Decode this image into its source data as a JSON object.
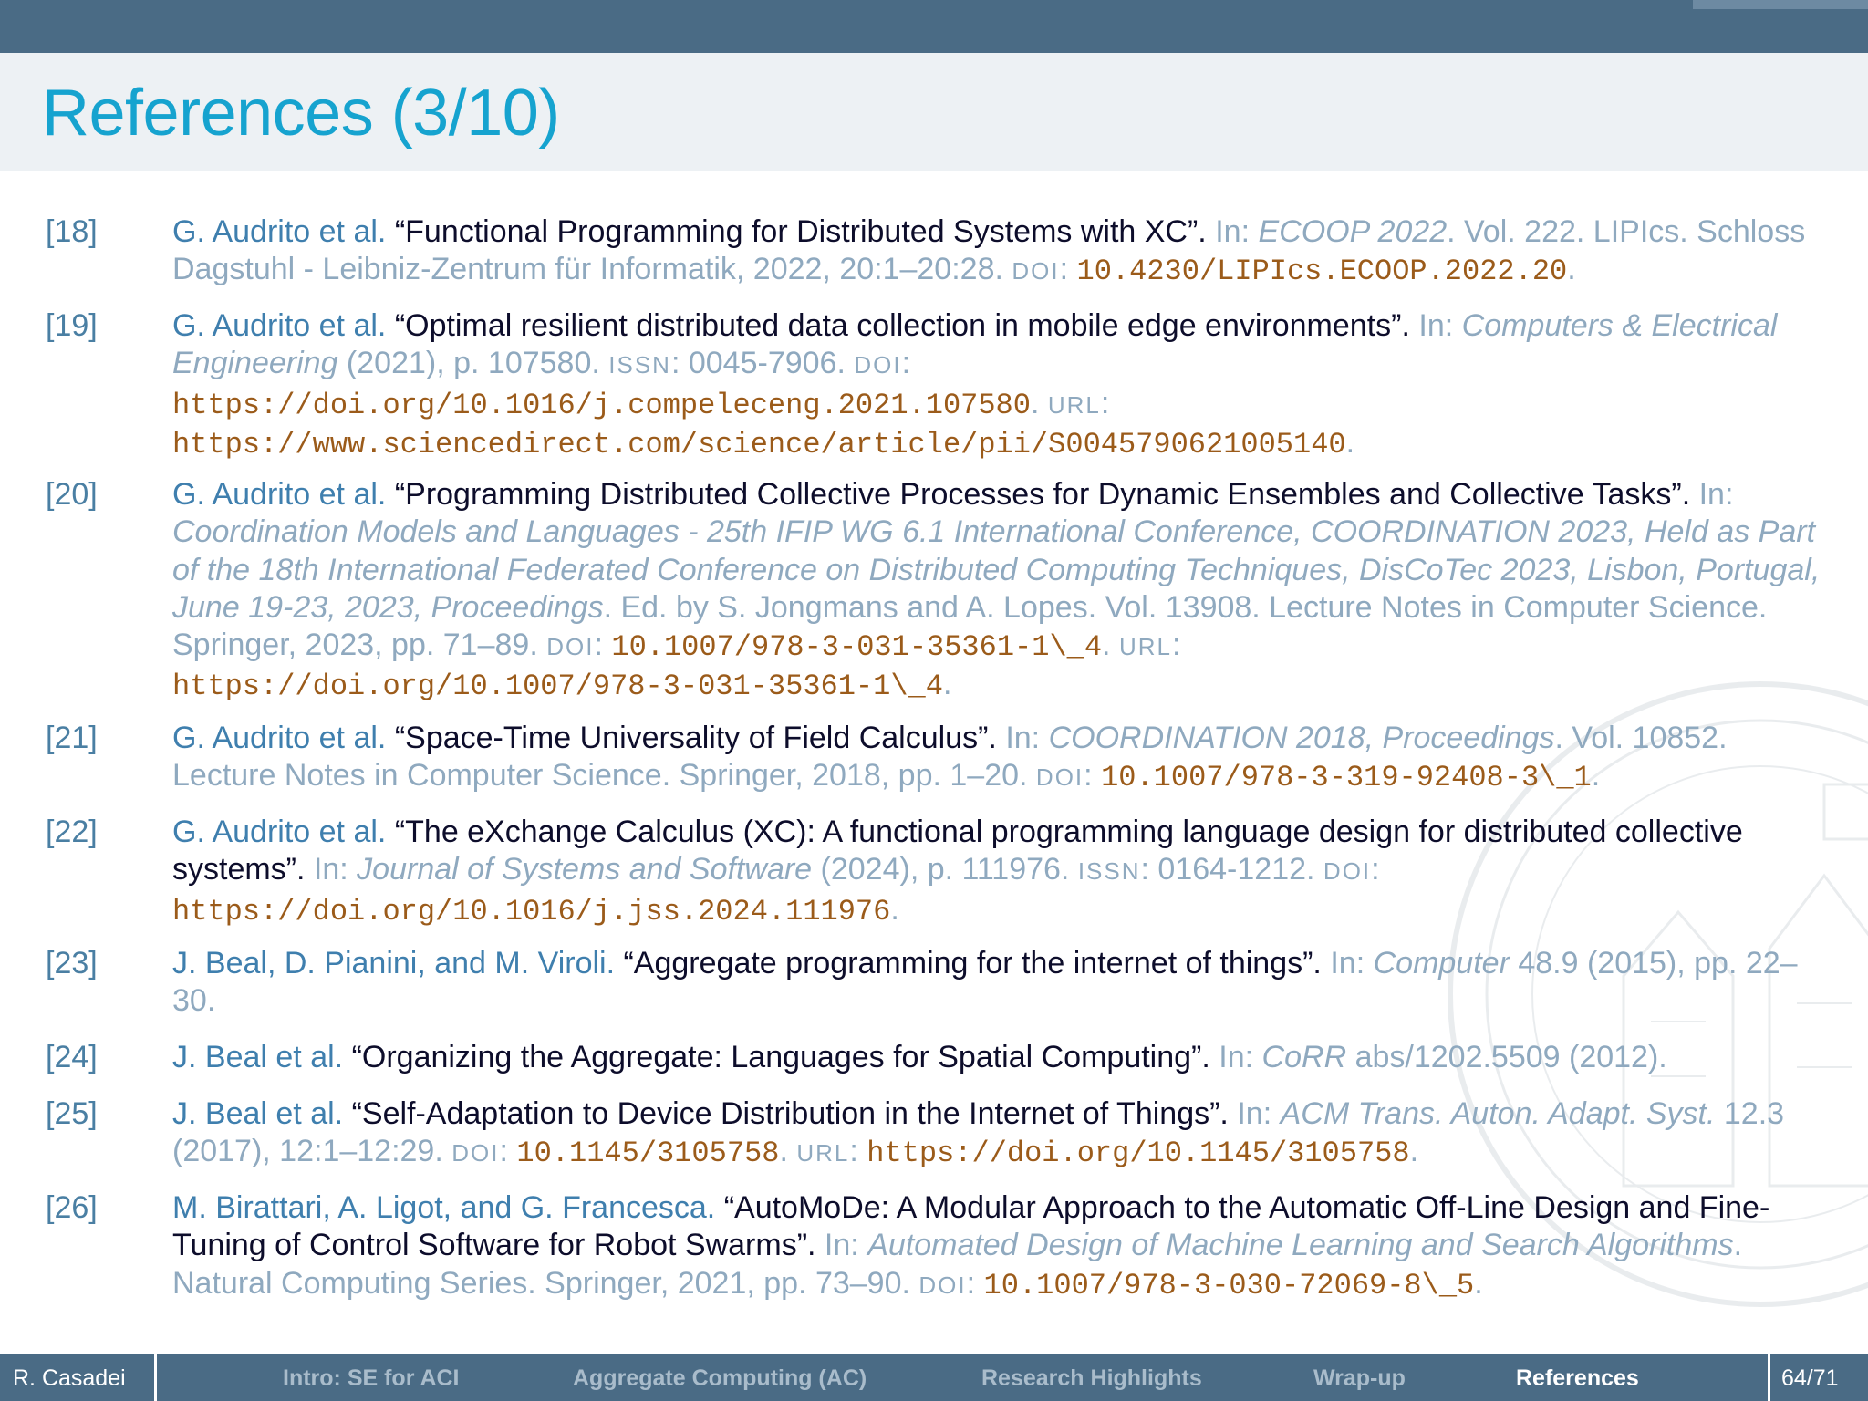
{
  "title": "References (3/10)",
  "references": [
    {
      "num": "[18]",
      "authors": "G. Audrito et al.",
      "title": "“Functional Programming for Distributed Systems with XC”.",
      "in": "In:",
      "venue": "ECOOP 2022",
      "rest": ". Vol. 222. LIPIcs. Schloss Dagstuhl - Leibniz-Zentrum für Informatik, 2022, 20:1–20:28.",
      "doi_label": "DOI",
      "doi": "10.4230/LIPIcs.ECOOP.2022.20"
    },
    {
      "num": "[19]",
      "authors": "G. Audrito et al.",
      "title": "“Optimal resilient distributed data collection in mobile edge environments”.",
      "in": "In:",
      "venue": "Computers & Electrical Engineering",
      "rest": " (2021), p. 107580.",
      "issn_label": "ISSN",
      "issn": "0045-7906.",
      "doi_label": "DOI",
      "doi": "https://doi.org/10.1016/j.compeleceng.2021.107580",
      "url_label": "URL",
      "url": "https://www.sciencedirect.com/science/article/pii/S0045790621005140"
    },
    {
      "num": "[20]",
      "authors": "G. Audrito et al.",
      "title": "“Programming Distributed Collective Processes for Dynamic Ensembles and Collective Tasks”.",
      "in": "In:",
      "venue": "Coordination Models and Languages - 25th IFIP WG 6.1 International Conference, COORDINATION 2023, Held as Part of the 18th International Federated Conference on Distributed Computing Techniques, DisCoTec 2023, Lisbon, Portugal, June 19-23, 2023, Proceedings",
      "rest": ". Ed. by S. Jongmans and A. Lopes. Vol. 13908. Lecture Notes in Computer Science. Springer, 2023, pp. 71–89.",
      "doi_label": "DOI",
      "doi": "10.1007/978-3-031-35361-1\\_4",
      "url_label": "URL",
      "url": "https://doi.org/10.1007/978-3-031-35361-1\\_4"
    },
    {
      "num": "[21]",
      "authors": "G. Audrito et al.",
      "title": "“Space-Time Universality of Field Calculus”.",
      "in": "In:",
      "venue": "COORDINATION 2018, Proceedings",
      "rest": ". Vol. 10852. Lecture Notes in Computer Science. Springer, 2018, pp. 1–20.",
      "doi_label": "DOI",
      "doi": "10.1007/978-3-319-92408-3\\_1"
    },
    {
      "num": "[22]",
      "authors": "G. Audrito et al.",
      "title": "“The eXchange Calculus (XC): A functional programming language design for distributed collective systems”.",
      "in": "In:",
      "venue": "Journal of Systems and Software",
      "rest": " (2024), p. 111976.",
      "issn_label": "ISSN",
      "issn": "0164-1212.",
      "doi_label": "DOI",
      "doi": "https://doi.org/10.1016/j.jss.2024.111976"
    },
    {
      "num": "[23]",
      "authors": "J. Beal, D. Pianini, and M. Viroli.",
      "title": "“Aggregate programming for the internet of things”.",
      "in": "In:",
      "venue": "Computer",
      "rest": " 48.9 (2015), pp. 22–30."
    },
    {
      "num": "[24]",
      "authors": "J. Beal et al.",
      "title": "“Organizing the Aggregate: Languages for Spatial Computing”.",
      "in": "In:",
      "venue": "CoRR",
      "rest": " abs/1202.5509 (2012)."
    },
    {
      "num": "[25]",
      "authors": "J. Beal et al.",
      "title": "“Self-Adaptation to Device Distribution in the Internet of Things”.",
      "in": "In:",
      "venue": "ACM Trans. Auton. Adapt. Syst.",
      "rest": " 12.3 (2017), 12:1–12:29.",
      "doi_label": "DOI",
      "doi": "10.1145/3105758",
      "url_label": "URL",
      "url": "https://doi.org/10.1145/3105758"
    },
    {
      "num": "[26]",
      "authors": "M. Birattari, A. Ligot, and G. Francesca.",
      "title": "“AutoMoDe: A Modular Approach to the Automatic Off-Line Design and Fine-Tuning of Control Software for Robot Swarms”.",
      "in": "In:",
      "venue": "Automated Design of Machine Learning and Search Algorithms",
      "rest": ". Natural Computing Series. Springer, 2021, pp. 73–90.",
      "doi_label": "DOI",
      "doi": "10.1007/978-3-030-72069-8\\_5"
    }
  ],
  "footer": {
    "author": "R. Casadei",
    "nav": [
      "Intro: SE for ACI",
      "Aggregate Computing (AC)",
      "Research Highlights",
      "Wrap-up",
      "References"
    ],
    "active": "References",
    "page": "64/71"
  },
  "colors": {
    "header_bar": "#4a6b85",
    "title": "#16a3cf",
    "authors": "#3f7fae",
    "meta": "#8fa9bf",
    "code": "#9b5b1a"
  }
}
